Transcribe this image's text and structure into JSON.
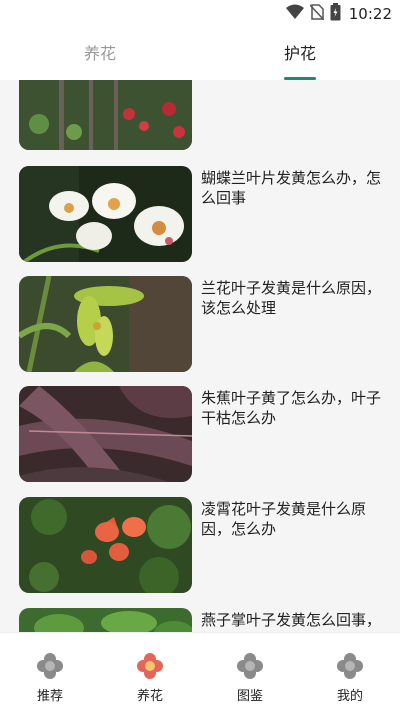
{
  "status_bar": {
    "time": "10:22",
    "icons": [
      "wifi-icon",
      "no-sim-icon",
      "battery-icon"
    ]
  },
  "tabs": [
    {
      "label": "养花",
      "active": false
    },
    {
      "label": "护花",
      "active": true
    }
  ],
  "articles": [
    {
      "title": "",
      "image": "red-flowers-garden"
    },
    {
      "title": "蝴蝶兰叶片发黄怎么办，怎么回事",
      "image": "white-orchids"
    },
    {
      "title": "兰花叶子发黄是什么原因，该怎么处理",
      "image": "green-orchid"
    },
    {
      "title": "朱蕉叶子黄了怎么办，叶子干枯怎么办",
      "image": "red-leaf-plant"
    },
    {
      "title": "凌霄花叶子发黄是什么原因，怎么办",
      "image": "orange-trumpet-flowers"
    },
    {
      "title": "燕子掌叶子发黄怎么回事，怎么办",
      "image": "jade-plant"
    }
  ],
  "bottom_nav": [
    {
      "label": "推荐",
      "icon": "flower-grey-icon",
      "active": false
    },
    {
      "label": "养花",
      "icon": "flower-color-icon",
      "active": true
    },
    {
      "label": "图鉴",
      "icon": "flower-grey-icon",
      "active": false
    },
    {
      "label": "我的",
      "icon": "flower-grey-icon",
      "active": false
    }
  ],
  "colors": {
    "accent": "#1b8a74",
    "background": "#f5f5f5"
  }
}
